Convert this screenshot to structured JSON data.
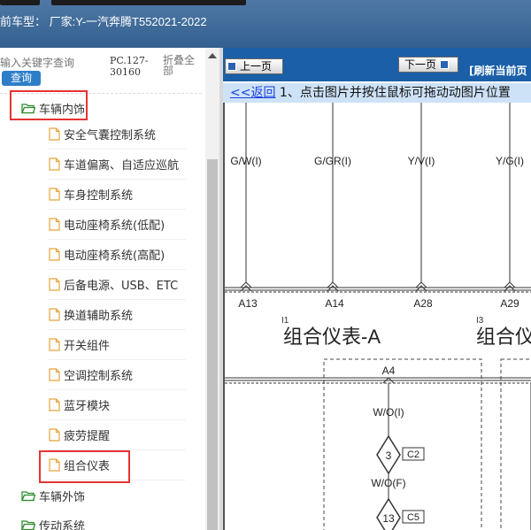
{
  "header": {
    "vehicle_label": "前车型：  厂家:Y-一汽奔腾T552021-2022"
  },
  "left_panel": {
    "search_placeholder": "输入关键字查询",
    "search_button": "查询",
    "pc_code": "PC.127-30160",
    "collapse_all": "折叠全部",
    "tree": [
      {
        "label": "车辆内饰",
        "type": "folder-open",
        "highlighted": true
      },
      {
        "label": "安全气囊控制系统",
        "type": "file"
      },
      {
        "label": "车道偏离、自适应巡航",
        "type": "file"
      },
      {
        "label": "车身控制系统",
        "type": "file"
      },
      {
        "label": "电动座椅系统(低配)",
        "type": "file"
      },
      {
        "label": "电动座椅系统(高配)",
        "type": "file"
      },
      {
        "label": "后备电源、USB、ETC",
        "type": "file"
      },
      {
        "label": "换道辅助系统",
        "type": "file"
      },
      {
        "label": "开关组件",
        "type": "file"
      },
      {
        "label": "空调控制系统",
        "type": "file"
      },
      {
        "label": "蓝牙模块",
        "type": "file"
      },
      {
        "label": "疲劳提醒",
        "type": "file"
      },
      {
        "label": "组合仪表",
        "type": "file",
        "highlighted": true
      },
      {
        "label": "车辆外饰",
        "type": "folder"
      },
      {
        "label": "传动系统",
        "type": "folder"
      }
    ]
  },
  "viewer": {
    "prev_button": "上一页",
    "next_button": "下一页",
    "refresh_label": "[刷新当前页",
    "back_link": "<<返回",
    "instruction": " 1、点击图片并按住鼠标可拖动动图片位置"
  },
  "diagram": {
    "wires": [
      "G/W(I)",
      "G/GR(I)",
      "Y/V(I)",
      "Y/G(I)"
    ],
    "pins": [
      "A13",
      "A14",
      "A28",
      "A29"
    ],
    "component_1": {
      "ref": "I1",
      "name": "组合仪表-A"
    },
    "component_2": {
      "ref": "I3",
      "name": "组合仪"
    },
    "connector_pin": "A4",
    "wire_2": "W/O(I)",
    "wire_3": "W/O(F)",
    "splice_1": {
      "number": "3",
      "label": "C2"
    },
    "splice_2": {
      "number": "13",
      "label": "C5"
    }
  }
}
